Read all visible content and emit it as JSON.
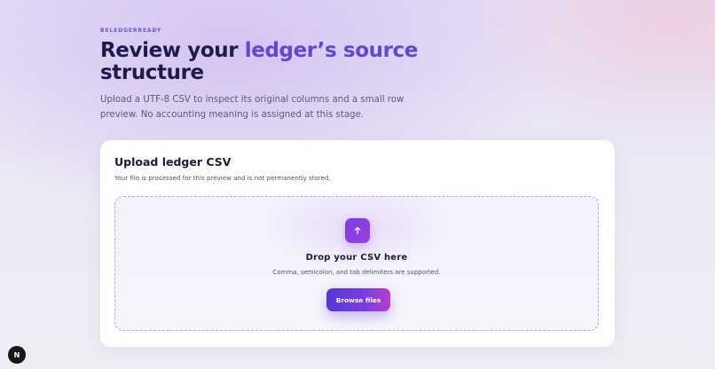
{
  "header": {
    "eyebrow": "BELEDGERREADY",
    "title_part1": "Review your ",
    "title_accent": "ledger’s source",
    "title_part2": "structure",
    "subtitle": "Upload a UTF-8 CSV to inspect its original columns and a small row preview. No accounting meaning is assigned at this stage."
  },
  "upload_card": {
    "title": "Upload ledger CSV",
    "description": "Your file is processed for this preview and is not permanently stored.",
    "dropzone": {
      "icon": "arrow-up-icon",
      "title": "Drop your CSV here",
      "description": "Comma, semicolon, and tab delimiters are supported.",
      "button_label": "Browse files"
    }
  },
  "dev_badge": {
    "label": "N",
    "icon": "next-logo-icon"
  },
  "colors": {
    "accent": "#6346d3",
    "button_start": "#5636d6",
    "button_end": "#b73fc9",
    "title": "#1e1a4a"
  }
}
